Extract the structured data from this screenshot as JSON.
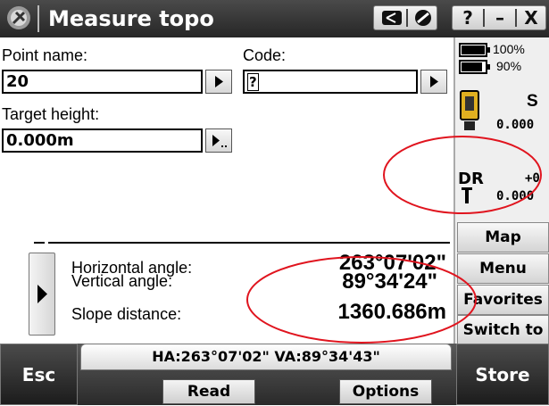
{
  "window": {
    "title": "Measure topo",
    "buttons": {
      "help": "?",
      "minimize": "–",
      "close": "X"
    }
  },
  "form": {
    "point_name_label": "Point name:",
    "point_name_value": "20",
    "code_label": "Code:",
    "code_value": "?",
    "target_height_label": "Target height:",
    "target_height_value": "0.000m"
  },
  "measurements": {
    "rows": [
      {
        "label": "Horizontal angle:",
        "value": "263°07'02\""
      },
      {
        "label": "Vertical angle:",
        "value": "89°34'24\""
      },
      {
        "label": "Slope distance:",
        "value": "1360.686m"
      }
    ],
    "status_line": "HA:263°07'02\"  VA:89°34'43\""
  },
  "status_panel": {
    "battery1": "100%",
    "battery2": "90%",
    "instrument_letter": "S",
    "instrument_value": "0.000",
    "dr_label": "DR",
    "dr_offset": "+0",
    "dr_value": "0.000"
  },
  "side_buttons": {
    "map": "Map",
    "menu": "Menu",
    "favorites": "Favorites",
    "switch_to": "Switch to"
  },
  "bottom": {
    "esc": "Esc",
    "read": "Read",
    "options": "Options",
    "store": "Store"
  },
  "colors": {
    "titlebar": "#2f2f2f",
    "annotation_circle": "#e0141e",
    "panel": "#efefef"
  }
}
